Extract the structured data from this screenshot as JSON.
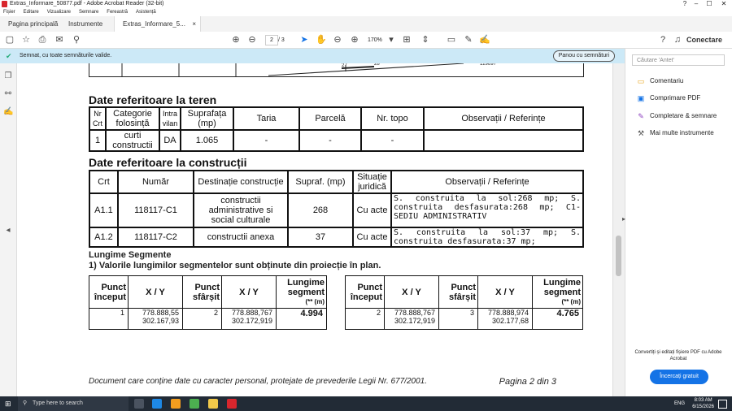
{
  "window": {
    "title": "Extras_Informare_50877.pdf - Adobe Acrobat Reader (32-bit)",
    "controls": {
      "minimize": "–",
      "maximize": "☐",
      "close": "✕",
      "help": "?"
    }
  },
  "menu": [
    "Fișier",
    "Editare",
    "Vizualizare",
    "Semnare",
    "Fereastră",
    "Asistență"
  ],
  "tabs": [
    {
      "label": "Pagina principală"
    },
    {
      "label": "Instrumente"
    },
    {
      "label": "Extras_Informare_5..."
    }
  ],
  "tab_close": "×",
  "toolbar": {
    "page_current": "2",
    "page_total": "/ 3",
    "zoom": "170%",
    "connect_label": "Conectare"
  },
  "signature_bar": {
    "message": "Semnat, cu toate semnăturile valide.",
    "panel_button": "Panou cu semnături"
  },
  "map_strip": {
    "label_a": "27",
    "label_b": "28",
    "label_c": "129897"
  },
  "teren": {
    "heading": "Date referitoare la teren",
    "headers": [
      "Nr Crt",
      "Categorie folosință",
      "Intra vilan",
      "Suprafața (mp)",
      "Taria",
      "Parcelă",
      "Nr. topo",
      "Observații / Referințe"
    ],
    "rows": [
      [
        "1",
        "curti constructii",
        "DA",
        "1.065",
        "-",
        "-",
        "-",
        ""
      ]
    ]
  },
  "constructii": {
    "heading": "Date referitoare la construcții",
    "headers": [
      "Crt",
      "Număr",
      "Destinație construcție",
      "Supraf. (mp)",
      "Situație juridică",
      "Observații / Referințe"
    ],
    "rows": [
      [
        "A1.1",
        "118117-C1",
        "constructii administrative si social culturale",
        "268",
        "Cu acte",
        "S. construita la sol:268 mp; S. construita desfasurata:268 mp; C1-SEDIU ADMINISTRATIV"
      ],
      [
        "A1.2",
        "118117-C2",
        "constructii anexa",
        "37",
        "Cu acte",
        "S. construita la sol:37 mp; S. construita desfasurata:37 mp;"
      ]
    ]
  },
  "segmente": {
    "heading": "Lungime Segmente",
    "subheading": "1) Valorile lungimilor segmentelor sunt obținute din proiecție în plan.",
    "headers": [
      "Punct început",
      "X / Y",
      "Punct sfârșit",
      "X / Y",
      "Lungime segment",
      "(** (m)"
    ],
    "table_left": [
      {
        "start": "1",
        "xy_start_x": "778.888,55",
        "xy_start_y": "302.167,93",
        "end": "2",
        "xy_end_x": "778.888,767",
        "xy_end_y": "302.172,919",
        "length": "4.994"
      }
    ],
    "table_right": [
      {
        "start": "2",
        "xy_start_x": "778.888,767",
        "xy_start_y": "302.172,919",
        "end": "3",
        "xy_end_x": "778.888,974",
        "xy_end_y": "302.177,68",
        "length": "4.765"
      }
    ]
  },
  "footer": {
    "text": "Document care conține date cu caracter personal, protejate de prevederile Legii Nr. 677/2001.",
    "page": "Pagina 2 din 3"
  },
  "right_pane": {
    "search_placeholder": "Căutare 'Antet'",
    "tools": [
      "Comentariu",
      "Comprimare PDF",
      "Completare & semnare",
      "Mai multe instrumente"
    ],
    "promo": "Convertiți și editați fișiere PDF cu Adobe Acrobat",
    "try_button": "Încercați gratuit"
  },
  "taskbar": {
    "search_placeholder": "Type here to search",
    "lang": "ENG",
    "time": "8:03 AM",
    "date": "6/15/2026"
  },
  "colors": {
    "accent": "#1473e6",
    "sigbar": "#cce9f7",
    "taskbar": "#222b36",
    "pdf_red": "#d8262d"
  }
}
